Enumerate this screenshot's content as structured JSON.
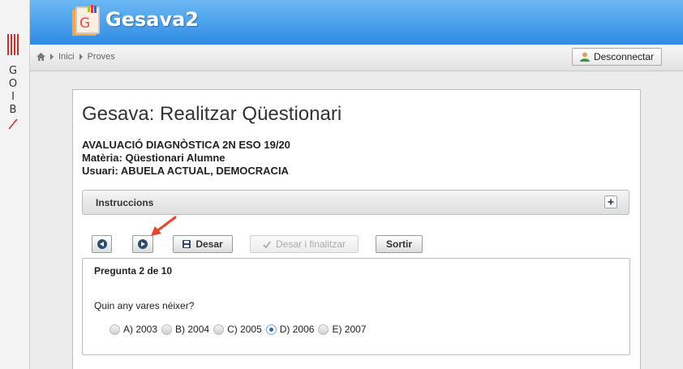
{
  "goib": {
    "letters": [
      "G",
      "O",
      "I",
      "B"
    ]
  },
  "header": {
    "app_title": "Gesava2",
    "app_icon_letter": "G"
  },
  "breadcrumb": {
    "items": [
      "Inici",
      "Proves"
    ]
  },
  "logout_label": "Desconnectar",
  "page": {
    "title": "Gesava: Realitzar Qüestionari",
    "meta": [
      "AVALUACIÓ DIAGNÒSTICA 2N ESO 19/20",
      "Matèria: Qüestionari Alumne",
      "Usuari: ABUELA ACTUAL, DEMOCRACIA"
    ]
  },
  "instructions_label": "Instruccions",
  "toolbar": {
    "save_label": "Desar",
    "save_finish_label": "Desar i finalitzar",
    "exit_label": "Sortir"
  },
  "question": {
    "number": "Pregunta 2 de 10",
    "text": "Quin any vares néixer?",
    "options": [
      "A) 2003",
      "B) 2004",
      "C) 2005",
      "D) 2006",
      "E) 2007"
    ],
    "selected": "D) 2006"
  },
  "colors": {
    "header": "#2f8be3",
    "accent_arrow": "#e8432b",
    "goib_red": "#e0242b"
  }
}
